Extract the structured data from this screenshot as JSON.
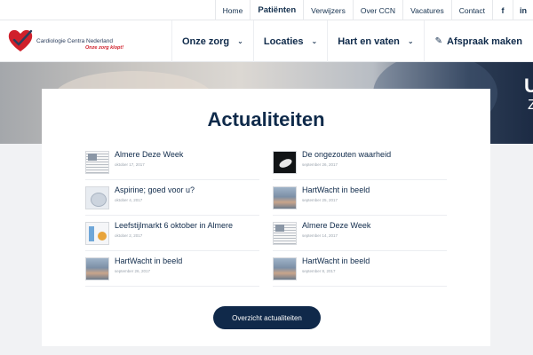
{
  "topnav": {
    "items": [
      "Home",
      "Patiënten",
      "Verwijzers",
      "Over CCN",
      "Vacatures",
      "Contact"
    ],
    "active": "Patiënten",
    "social": [
      "f",
      "in"
    ]
  },
  "logo": {
    "name": "Cardiologie Centra Nederland",
    "slogan": "Onze zorg klopt!",
    "icon": "heart-check-icon"
  },
  "mainnav": {
    "items": [
      "Onze zorg",
      "Locaties",
      "Hart en vaten"
    ],
    "cta": "Afspraak maken",
    "cta_icon": "pencil-square-icon"
  },
  "hero": {
    "letters": [
      "U",
      "Z"
    ]
  },
  "news": {
    "title": "Actualiteiten",
    "items": [
      {
        "title": "Almere Deze Week",
        "date": "oktober 17, 2017",
        "thumb": "doc"
      },
      {
        "title": "De ongezouten waarheid",
        "date": "september 26, 2017",
        "thumb": "dark"
      },
      {
        "title": "Aspirine; goed voor u?",
        "date": "oktober 4, 2017",
        "thumb": "pills"
      },
      {
        "title": "HartWacht in beeld",
        "date": "september 25, 2017",
        "thumb": "photo"
      },
      {
        "title": "Leefstijlmarkt 6 oktober in Almere",
        "date": "oktober 2, 2017",
        "thumb": "market"
      },
      {
        "title": "Almere Deze Week",
        "date": "september 14, 2017",
        "thumb": "doc"
      },
      {
        "title": "HartWacht in beeld",
        "date": "september 26, 2017",
        "thumb": "photo"
      },
      {
        "title": "HartWacht in beeld",
        "date": "september 8, 2017",
        "thumb": "photo"
      }
    ],
    "button": "Overzicht actualiteiten"
  },
  "colors": {
    "navy": "#0f2a4a",
    "brand_red": "#d0202b",
    "button": "#10294a"
  }
}
